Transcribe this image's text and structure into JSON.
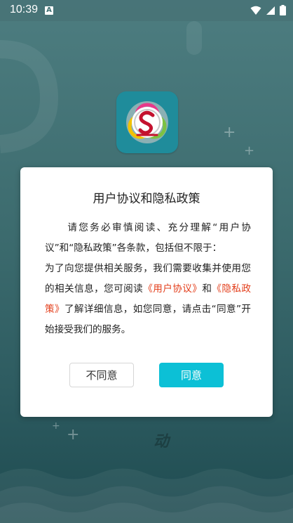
{
  "status_bar": {
    "time": "10:39",
    "notification_icon": "A",
    "icons": [
      "wifi-icon",
      "signal-icon",
      "battery-icon"
    ]
  },
  "splash": {
    "bottom_text": "动",
    "app_icon": "app-logo-icon"
  },
  "dialog": {
    "title": "用户协议和隐私政策",
    "body": {
      "p1": "请您务必审慎阅读、充分理解“用户协议”和“隐私政策”各条款，包括但不限于：",
      "p2_a": "为了向您提供相关服务，我们需要收集并使用您的相关信息，您可阅读",
      "link_user_agreement": "《用户协议》",
      "p2_b": "和",
      "link_privacy_policy": "《隐私政策》",
      "p2_c": "了解详细信息，如您同意，请点击“同意”开始接受我们的服务。"
    },
    "buttons": {
      "disagree": "不同意",
      "agree": "同意"
    }
  },
  "colors": {
    "accent": "#0cc0d6",
    "link": "#e33d1a",
    "background": "#3e6f72"
  }
}
